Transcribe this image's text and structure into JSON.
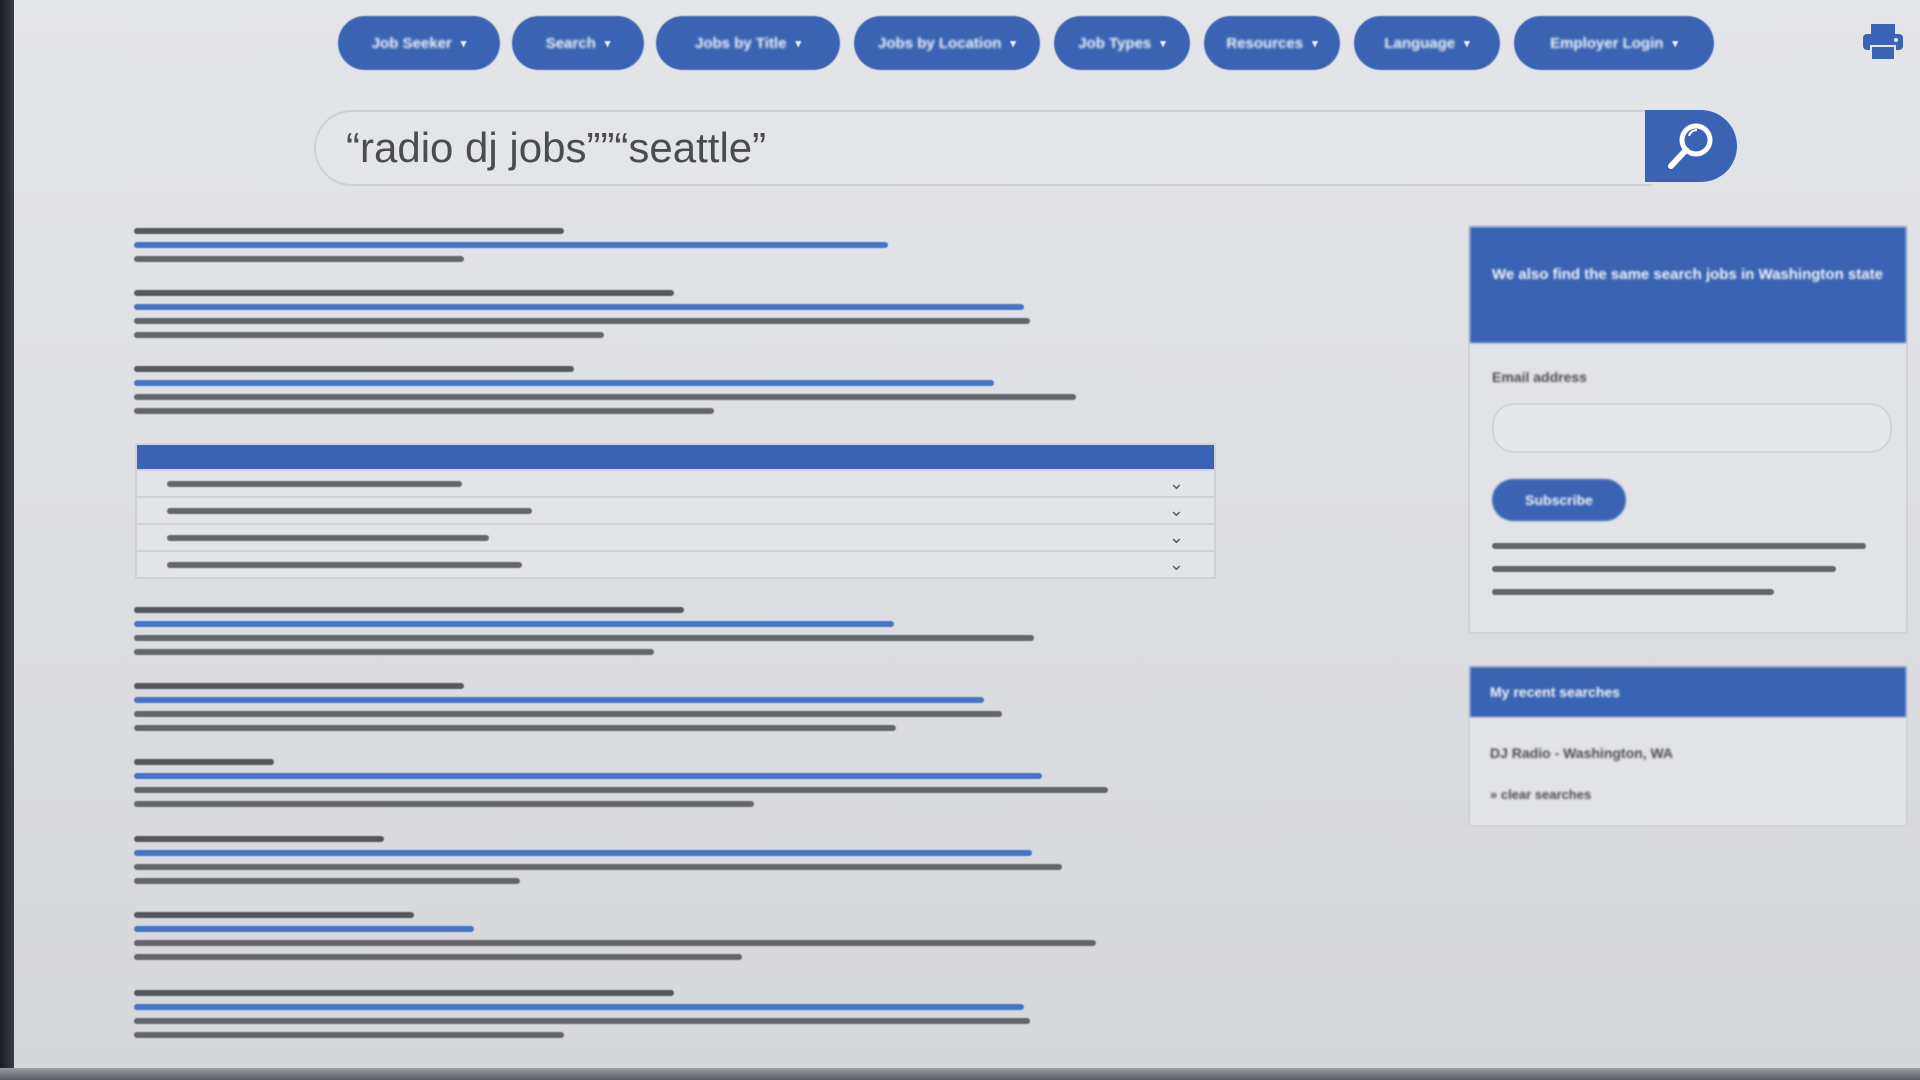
{
  "nav": {
    "items": [
      {
        "label": "Job Seeker"
      },
      {
        "label": "Search"
      },
      {
        "label": "Jobs by Title"
      },
      {
        "label": "Jobs by Location"
      },
      {
        "label": "Job Types"
      },
      {
        "label": "Resources"
      },
      {
        "label": "Language"
      },
      {
        "label": "Employer Login"
      }
    ],
    "caret": "▾"
  },
  "search": {
    "query": "“radio dj jobs””“seattle”"
  },
  "accordion": {
    "chevron": "⌄"
  },
  "sidebar": {
    "subscribe": {
      "heading": "We also find the same search jobs in Washington state",
      "email_label": "Email address",
      "email_placeholder": "",
      "button_label": "Subscribe"
    },
    "saved_searches": {
      "heading": "My recent searches",
      "item": "DJ Radio - Washington, WA",
      "clear_link": "» clear searches"
    }
  },
  "colors": {
    "accent": "#3a64b3",
    "link": "#3f6ec4",
    "text": "#5d5f65",
    "background": "#dcdde0"
  }
}
